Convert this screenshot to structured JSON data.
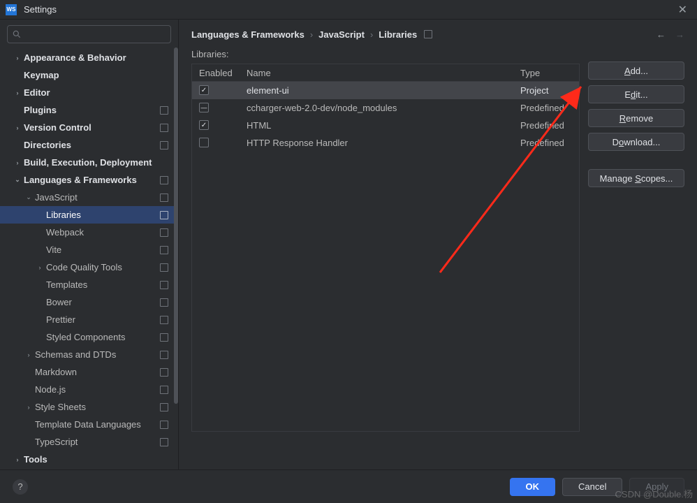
{
  "window": {
    "title": "Settings"
  },
  "search": {
    "placeholder": ""
  },
  "sidebar": {
    "items": [
      {
        "label": "Appearance & Behavior",
        "depth": 0,
        "chev": "›",
        "bold": true,
        "endIcon": false
      },
      {
        "label": "Keymap",
        "depth": 0,
        "chev": "",
        "bold": true,
        "endIcon": false
      },
      {
        "label": "Editor",
        "depth": 0,
        "chev": "›",
        "bold": true,
        "endIcon": false
      },
      {
        "label": "Plugins",
        "depth": 0,
        "chev": "",
        "bold": true,
        "endIcon": true
      },
      {
        "label": "Version Control",
        "depth": 0,
        "chev": "›",
        "bold": true,
        "endIcon": true
      },
      {
        "label": "Directories",
        "depth": 0,
        "chev": "",
        "bold": true,
        "endIcon": true
      },
      {
        "label": "Build, Execution, Deployment",
        "depth": 0,
        "chev": "›",
        "bold": true,
        "endIcon": false
      },
      {
        "label": "Languages & Frameworks",
        "depth": 0,
        "chev": "⌄",
        "bold": true,
        "endIcon": true
      },
      {
        "label": "JavaScript",
        "depth": 1,
        "chev": "⌄",
        "bold": false,
        "endIcon": true
      },
      {
        "label": "Libraries",
        "depth": 2,
        "chev": "",
        "bold": false,
        "endIcon": true,
        "selected": true
      },
      {
        "label": "Webpack",
        "depth": 2,
        "chev": "",
        "bold": false,
        "endIcon": true
      },
      {
        "label": "Vite",
        "depth": 2,
        "chev": "",
        "bold": false,
        "endIcon": true
      },
      {
        "label": "Code Quality Tools",
        "depth": 2,
        "chev": "›",
        "bold": false,
        "endIcon": true
      },
      {
        "label": "Templates",
        "depth": 2,
        "chev": "",
        "bold": false,
        "endIcon": true
      },
      {
        "label": "Bower",
        "depth": 2,
        "chev": "",
        "bold": false,
        "endIcon": true
      },
      {
        "label": "Prettier",
        "depth": 2,
        "chev": "",
        "bold": false,
        "endIcon": true
      },
      {
        "label": "Styled Components",
        "depth": 2,
        "chev": "",
        "bold": false,
        "endIcon": true
      },
      {
        "label": "Schemas and DTDs",
        "depth": 1,
        "chev": "›",
        "bold": false,
        "endIcon": true
      },
      {
        "label": "Markdown",
        "depth": 1,
        "chev": "",
        "bold": false,
        "endIcon": true
      },
      {
        "label": "Node.js",
        "depth": 1,
        "chev": "",
        "bold": false,
        "endIcon": true
      },
      {
        "label": "Style Sheets",
        "depth": 1,
        "chev": "›",
        "bold": false,
        "endIcon": true
      },
      {
        "label": "Template Data Languages",
        "depth": 1,
        "chev": "",
        "bold": false,
        "endIcon": true
      },
      {
        "label": "TypeScript",
        "depth": 1,
        "chev": "",
        "bold": false,
        "endIcon": true
      },
      {
        "label": "Tools",
        "depth": 0,
        "chev": "›",
        "bold": true,
        "endIcon": false
      }
    ]
  },
  "breadcrumb": {
    "parts": [
      "Languages & Frameworks",
      "JavaScript",
      "Libraries"
    ]
  },
  "main": {
    "sectionLabel": "Libraries:",
    "columns": {
      "enabled": "Enabled",
      "name": "Name",
      "type": "Type"
    },
    "rows": [
      {
        "state": "checked",
        "name": "element-ui",
        "type": "Project",
        "selected": true
      },
      {
        "state": "mixed",
        "name": "ccharger-web-2.0-dev/node_modules",
        "type": "Predefined",
        "selected": false
      },
      {
        "state": "checked",
        "name": "HTML",
        "type": "Predefined",
        "selected": false
      },
      {
        "state": "",
        "name": "HTTP Response Handler",
        "type": "Predefined",
        "selected": false
      }
    ],
    "buttons": {
      "add": "Add...",
      "edit": "Edit...",
      "remove": "Remove",
      "download": "Download...",
      "manageScopes": "Manage Scopes..."
    }
  },
  "footer": {
    "ok": "OK",
    "cancel": "Cancel",
    "apply": "Apply"
  },
  "watermark": "CSDN @Double.杨"
}
